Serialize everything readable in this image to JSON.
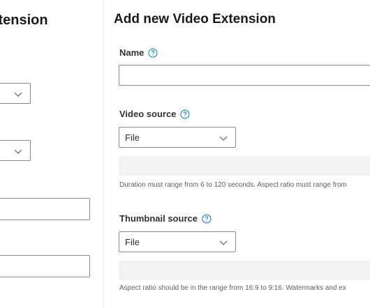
{
  "left_panel": {
    "title": "Extension"
  },
  "right_panel": {
    "title": "Add new Video Extension",
    "name_field": {
      "label": "Name",
      "value": ""
    },
    "video_source": {
      "label": "Video source",
      "selected": "File",
      "help_text": "Duration must range from 6 to 120 seconds. Aspect ratio must range from"
    },
    "thumbnail_source": {
      "label": "Thumbnail source",
      "selected": "File",
      "help_text": "Aspect ratio should be in the range from 16:9 to 9:16. Watermarks and ex"
    }
  },
  "icons": {
    "help": "help-circle-icon",
    "chevron": "chevron-down-icon"
  },
  "colors": {
    "accent": "#0078d4",
    "border": "#8a8886",
    "upload_bg": "#f3f2f1",
    "help_text": "#605e5c"
  }
}
